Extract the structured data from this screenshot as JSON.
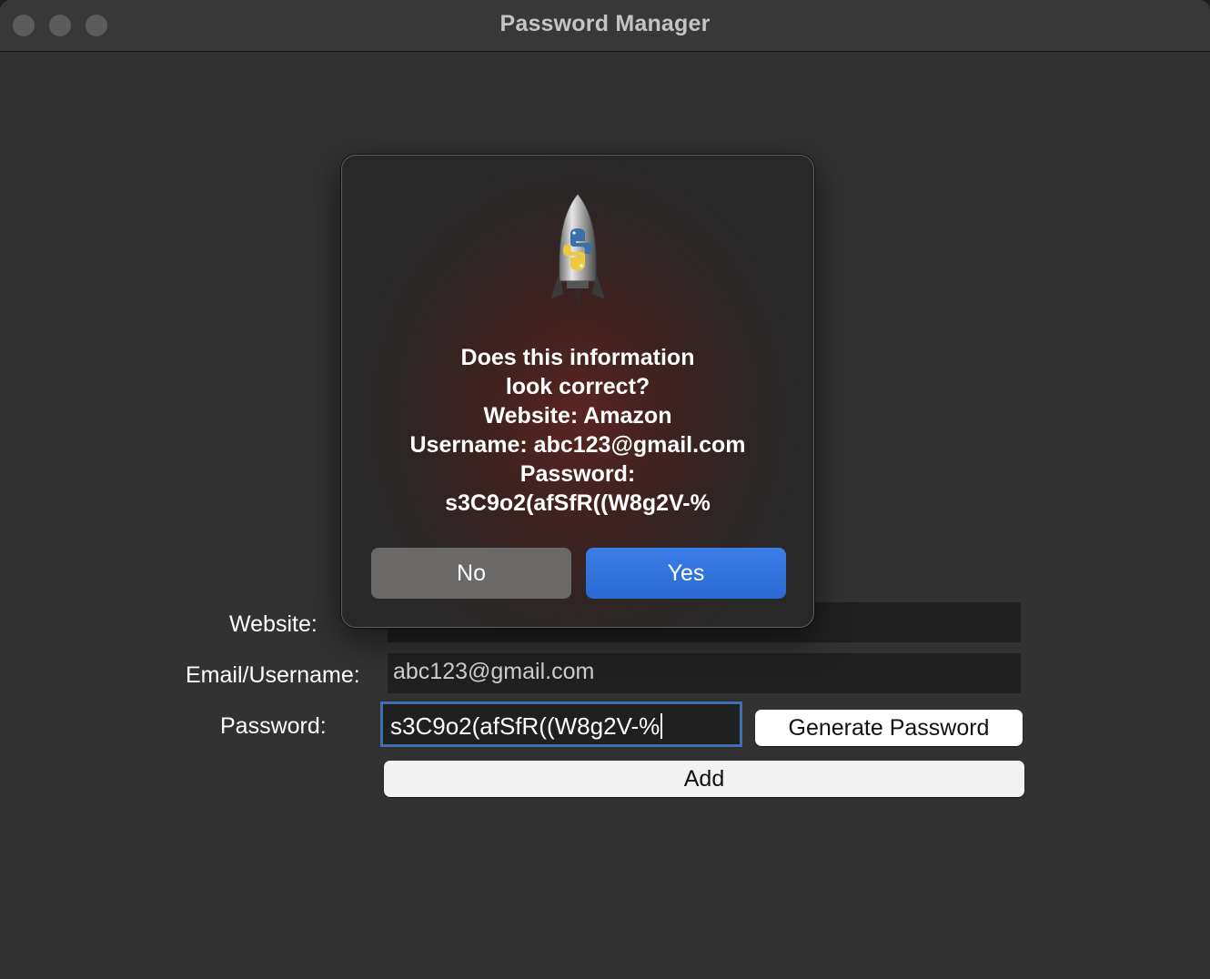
{
  "window": {
    "title": "Password Manager"
  },
  "form": {
    "website_label": "Website:",
    "website_value": "Amazon",
    "email_label": "Email/Username:",
    "email_value": "abc123@gmail.com",
    "password_label": "Password:",
    "password_value": "s3C9o2(afSfR((W8g2V-%",
    "generate_button": "Generate Password",
    "add_button": "Add"
  },
  "dialog": {
    "icon": "python-launcher-rocket-icon",
    "lines": [
      "Does this information",
      "look correct?",
      "Website: Amazon",
      "Username: abc123@gmail.com",
      "Password:",
      "s3C9o2(afSfR((W8g2V-%"
    ],
    "no_button": "No",
    "yes_button": "Yes"
  },
  "colors": {
    "accent": "#2b69d3",
    "focus_ring": "#3f6fb1",
    "window_bg": "#323232"
  }
}
